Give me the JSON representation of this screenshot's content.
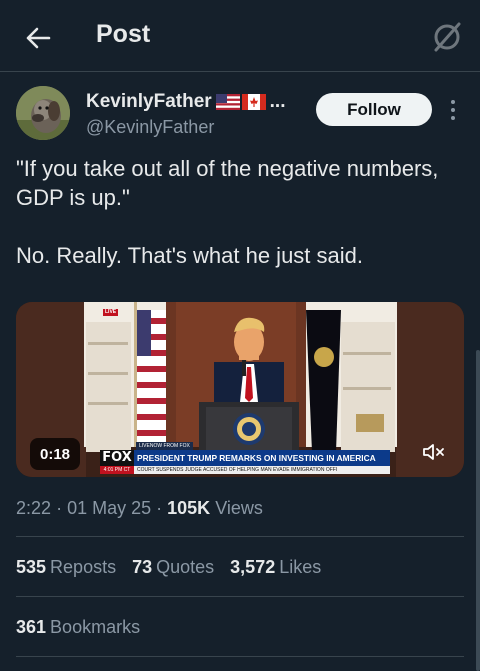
{
  "header": {
    "title": "Post"
  },
  "author": {
    "display_name": "KevinlyFather",
    "ellipsis": "...",
    "handle": "@KevinlyFather"
  },
  "follow_label": "Follow",
  "post": {
    "text": "\"If you take out all of the negative numbers, GDP is up.\"\n\nNo. Really. That's what he just said."
  },
  "video": {
    "duration": "0:18",
    "live_tag": "LIVE",
    "chyron": {
      "top": "LIVENOW FROM FOX",
      "network": "FOX",
      "headline": "PRESIDENT TRUMP REMARKS ON INVESTING IN AMERICA",
      "time": "4:01 PM CT",
      "ticker": "COURT SUSPENDS JUDGE ACCUSED OF HELPING MAN EVADE IMMIGRATION OFFI"
    }
  },
  "meta": {
    "time": "2:22",
    "date": "01 May 25",
    "views_count": "105K",
    "views_label": "Views"
  },
  "stats": [
    {
      "count": "535",
      "label": "Reposts"
    },
    {
      "count": "73",
      "label": "Quotes"
    },
    {
      "count": "3,572",
      "label": "Likes"
    }
  ],
  "bookmarks": {
    "count": "361",
    "label": "Bookmarks"
  },
  "colors": {
    "background": "#15202b",
    "text": "#e7e9ea",
    "secondary": "#8b98a5",
    "divider": "#38444d"
  },
  "icons": [
    "back-arrow-icon",
    "x-logo-icon",
    "more-vertical-icon",
    "us-flag-icon",
    "canada-flag-icon",
    "mute-icon"
  ]
}
